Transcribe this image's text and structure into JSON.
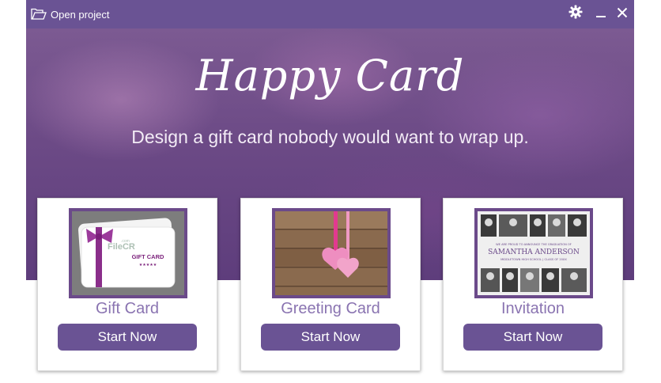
{
  "titlebar": {
    "open_label": "Open project",
    "icons": [
      "folder-icon",
      "gear-icon",
      "minimize-icon",
      "close-icon"
    ]
  },
  "hero": {
    "title": "Happy Card",
    "subtitle": "Design a gift card nobody would want to wrap up."
  },
  "cards": [
    {
      "title": "Gift Card",
      "button": "Start Now",
      "thumb_text": "GIFT CARD",
      "thumb_stars": "★★★★★",
      "thumb_watermark": "FileCR",
      "thumb_watermark_sub": ".com"
    },
    {
      "title": "Greeting Card",
      "button": "Start Now"
    },
    {
      "title": "Invitation",
      "button": "Start Now",
      "thumb_line1": "WE ARE PROUD TO ANNOUNCE THE GRADUATION OF",
      "thumb_name": "SAMANTHA ANDERSON",
      "thumb_line2": "MIDDLETOWN HIGH SCHOOL | CLASS OF 20XX"
    }
  ],
  "colors": {
    "titlebar": "#6a5394",
    "button": "#6a5394",
    "card_title": "#8a74b1",
    "thumb_frame": "#6b4a8a"
  }
}
